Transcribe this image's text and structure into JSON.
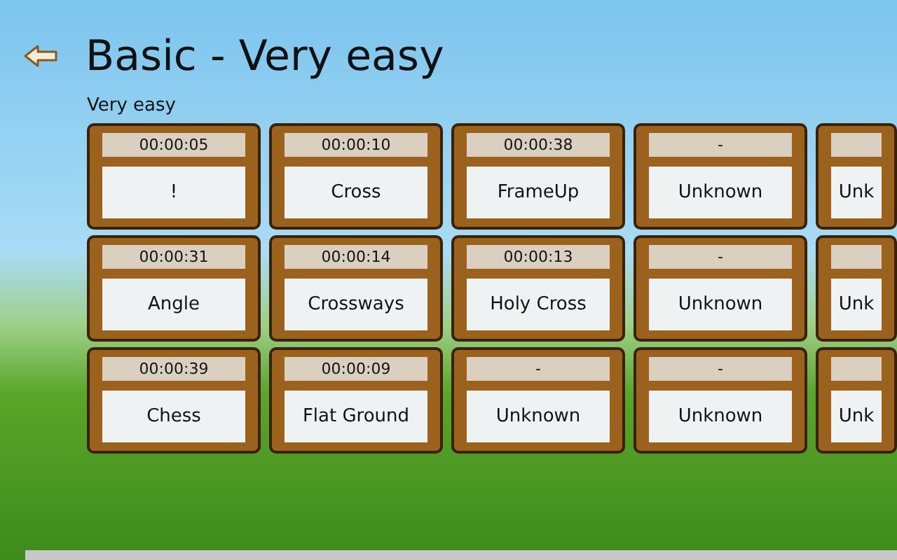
{
  "header": {
    "title": "Basic - Very easy"
  },
  "group": {
    "label": "Very easy"
  },
  "levels": [
    {
      "time": "00:00:05",
      "name": "!"
    },
    {
      "time": "00:00:31",
      "name": "Angle"
    },
    {
      "time": "00:00:39",
      "name": "Chess"
    },
    {
      "time": "00:00:10",
      "name": "Cross"
    },
    {
      "time": "00:00:14",
      "name": "Crossways"
    },
    {
      "time": "00:00:09",
      "name": "Flat Ground"
    },
    {
      "time": "00:00:38",
      "name": "FrameUp"
    },
    {
      "time": "00:00:13",
      "name": "Holy Cross"
    },
    {
      "time": "-",
      "name": "Unknown"
    },
    {
      "time": "-",
      "name": "Unknown"
    },
    {
      "time": "-",
      "name": "Unknown"
    },
    {
      "time": "-",
      "name": "Unknown"
    },
    {
      "name": "Unk"
    },
    {
      "name": "Unk"
    },
    {
      "name": "Unk"
    }
  ]
}
